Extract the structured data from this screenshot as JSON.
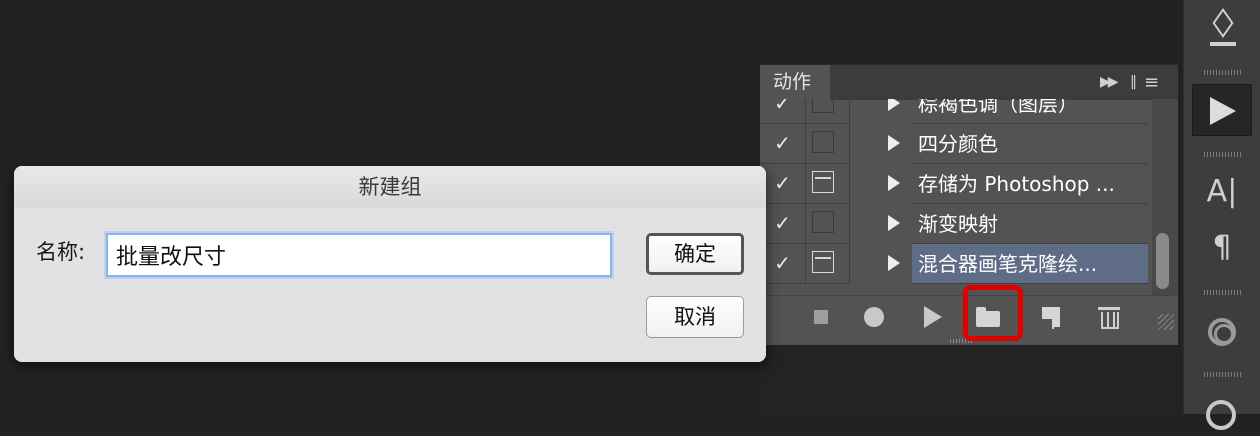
{
  "panel": {
    "tab_label": "动作",
    "collapse_icon": "double-chevron-right-icon",
    "menu_icon": "panel-menu-icon",
    "rows": [
      {
        "checked": "✓",
        "dialog_toggle": false,
        "name": "棕褐色调（图层）"
      },
      {
        "checked": "✓",
        "dialog_toggle": false,
        "name": "四分颜色"
      },
      {
        "checked": "✓",
        "dialog_toggle": true,
        "name": "存储为 Photoshop ..."
      },
      {
        "checked": "✓",
        "dialog_toggle": false,
        "name": "渐变映射"
      },
      {
        "checked": "✓",
        "dialog_toggle": true,
        "name": "混合器画笔克隆绘..."
      }
    ],
    "toolbar_icons": [
      "stop-icon",
      "record-icon",
      "play-icon",
      "folder-icon",
      "new-action-icon",
      "trash-icon"
    ],
    "highlight_color": "#e10000",
    "selected_row_color": "#5e6c86"
  },
  "dock": {
    "icons": [
      "3d-icon",
      "actions-play-icon",
      "character-icon",
      "paragraph-icon",
      "clone-source-icon",
      "creative-cloud-icon"
    ],
    "character_glyph": "A|",
    "paragraph_glyph": "¶"
  },
  "dialog": {
    "title": "新建组",
    "name_label": "名称:",
    "name_value": "批量改尺寸",
    "ok_label": "确定",
    "cancel_label": "取消"
  }
}
